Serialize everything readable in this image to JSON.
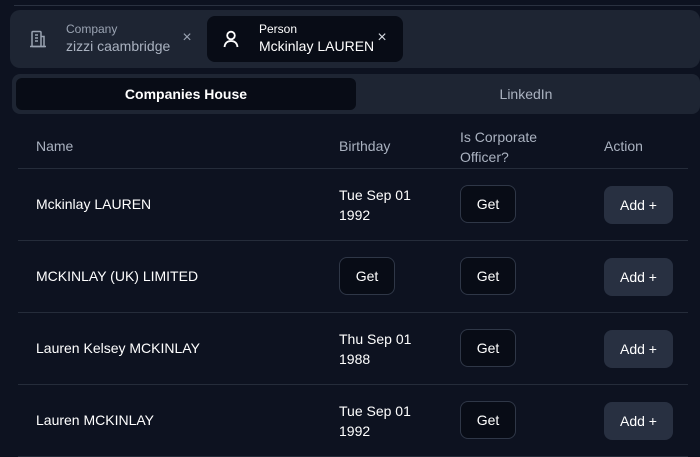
{
  "entity_tabs": {
    "company": {
      "kind": "Company",
      "value": "zizzi caambridge",
      "icon": "building-icon",
      "close": "×"
    },
    "person": {
      "kind": "Person",
      "value": "Mckinlay LAUREN",
      "icon": "user-icon",
      "close": "×"
    }
  },
  "source_tabs": {
    "active": "Companies House",
    "inactive": "LinkedIn"
  },
  "table": {
    "headers": {
      "name": "Name",
      "birthday": "Birthday",
      "corporate_officer": "Is Corporate Officer?",
      "action": "Action"
    },
    "rows": [
      {
        "name": "Mckinlay LAUREN",
        "birthday": "Tue Sep 01 1992",
        "officer_button": "Get",
        "action": "Add +"
      },
      {
        "name": "MCKINLAY (UK) LIMITED",
        "birthday_button": "Get",
        "officer_button": "Get",
        "action": "Add +"
      },
      {
        "name": "Lauren Kelsey MCKINLAY",
        "birthday": "Thu Sep 01 1988",
        "officer_button": "Get",
        "action": "Add +"
      },
      {
        "name": "Lauren MCKINLAY",
        "birthday": "Tue Sep 01 1992",
        "officer_button": "Get",
        "action": "Add +"
      }
    ]
  }
}
